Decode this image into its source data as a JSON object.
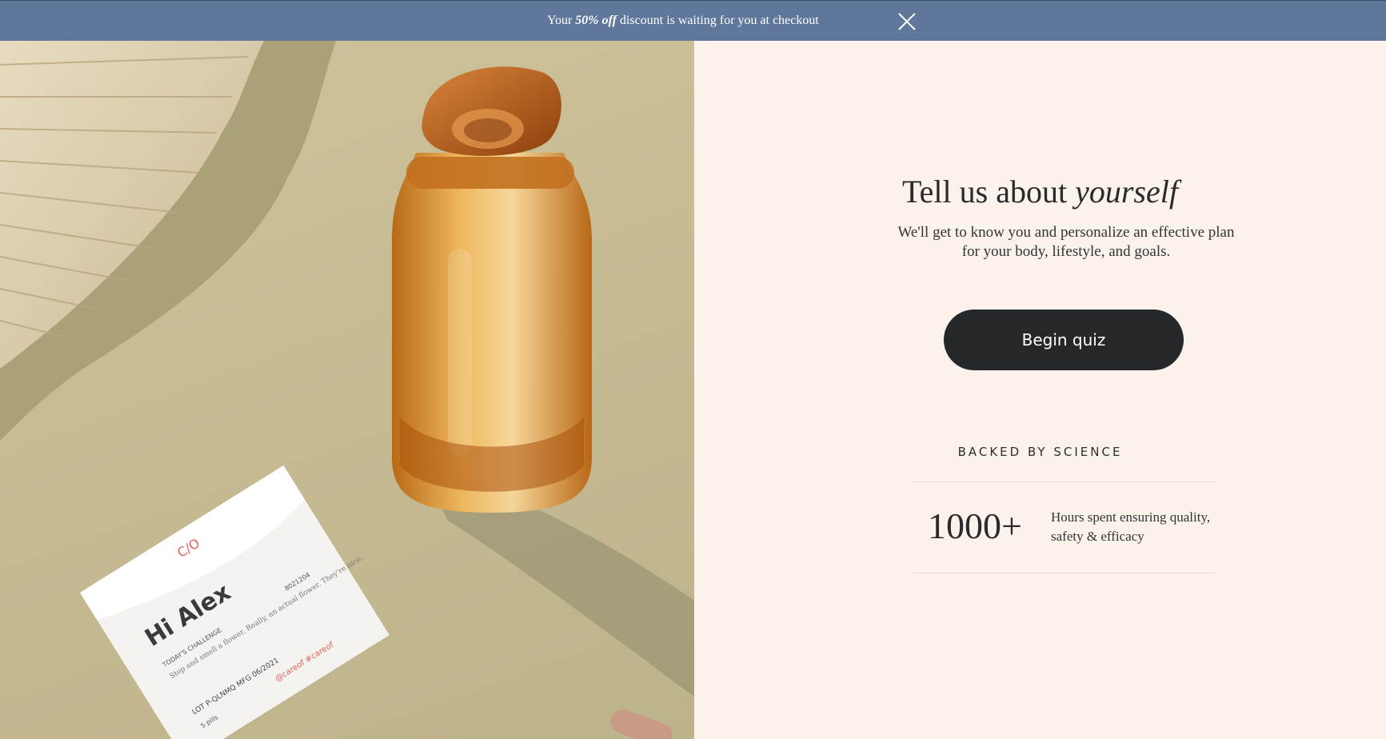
{
  "banner": {
    "message_prefix": "Your ",
    "message_bold": "50% off",
    "message_suffix": " discount is waiting for you at checkout",
    "close_icon": "close-icon"
  },
  "hero_image": {
    "packet_brand": "C/O",
    "packet_greeting": "Hi Alex",
    "packet_challenge_label": "TODAY'S CHALLENGE",
    "packet_challenge_text": "Stop and smell a flower. Really, an actual flower. They're nice.",
    "packet_code": "8021204",
    "packet_lot": "LOT P-QLNMQ  MFG 06/2021",
    "packet_social": "@careof #careof",
    "packet_pills": "5 pills"
  },
  "main": {
    "title_plain": "Tell us about ",
    "title_italic": "yourself",
    "subtitle": "We'll get to know you and personalize an effective plan for your body, lifestyle, and goals.",
    "cta_label": "Begin quiz"
  },
  "science": {
    "label": "BACKED BY SCIENCE",
    "stat_value": "1000+",
    "stat_description": "Hours spent ensuring quality, safety & efficacy"
  },
  "colors": {
    "banner_bg": "#5e779a",
    "panel_bg": "#fbf2ec",
    "cta_bg": "#24282b"
  }
}
